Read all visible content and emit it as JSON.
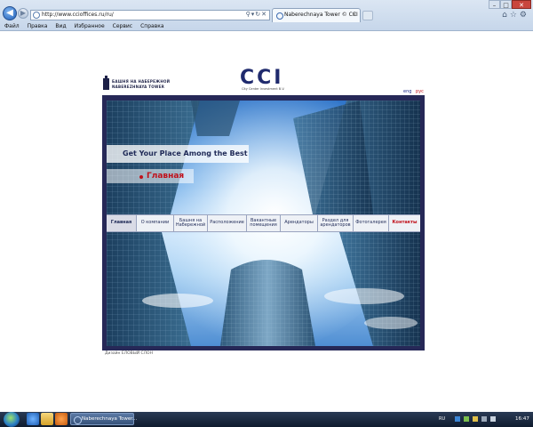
{
  "browser": {
    "url": "http://www.ccioffices.ru/ru/",
    "tab_title": "Naberechnaya Tower © CCI",
    "menu": [
      "Файл",
      "Правка",
      "Вид",
      "Избранное",
      "Сервис",
      "Справка"
    ],
    "icons": {
      "back": "back-arrow-icon",
      "forward": "forward-arrow-icon",
      "page": "page-icon",
      "address_tools": "search-refresh-stop-icons",
      "window_controls": [
        "minimize-icon",
        "maximize-icon",
        "close-icon"
      ],
      "right_tools": [
        "home-icon",
        "favorites-star-icon",
        "settings-gear-icon"
      ]
    }
  },
  "site": {
    "logo_left": {
      "line1": "БАШНЯ НА НАБЕРЕЖНОЙ",
      "line2": "NABEREZHNAYA TOWER"
    },
    "logo_center": {
      "mark": "CCI",
      "sub": "City Center Investment B.V."
    },
    "lang": {
      "en": "eng",
      "ru": "рус"
    },
    "tagline": "Get Your Place Among the Best",
    "current_section": "Главная",
    "nav": [
      "Главная",
      "О компании",
      "Башня на Набережной",
      "Расположение",
      "Вакантные помещения",
      "Арендаторы",
      "Раздел для арендаторов",
      "Фотогалерея",
      "Контакты"
    ],
    "credit": "Дизайн ЕЛОВЫЙ СЛОН"
  },
  "taskbar": {
    "task_label": "Naberechnaya Tower...",
    "lang": "RU",
    "time": "16:47"
  },
  "colors": {
    "frame": "#262857",
    "accent_red": "#c0101a",
    "brand_navy": "#1f2a6d"
  }
}
